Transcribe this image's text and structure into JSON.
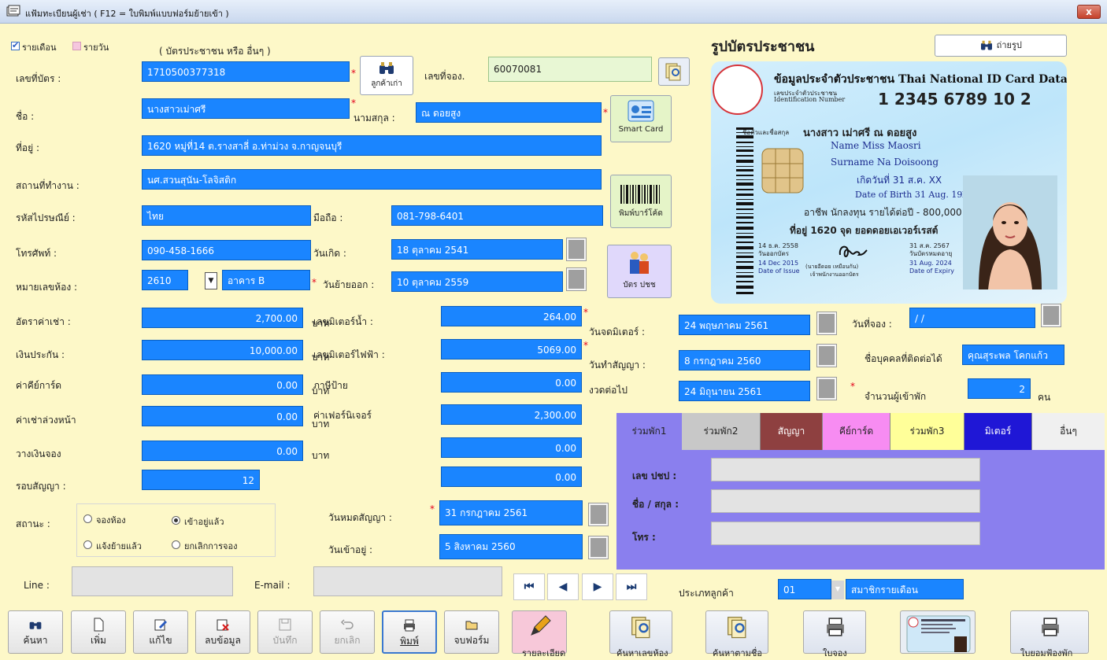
{
  "window": {
    "title": "แฟ้มทะเบียนผู้เช่า ( F12 = ใบพิมพ์แบบฟอร์มย้ายเข้า )",
    "close": "x"
  },
  "rental_type": {
    "monthly": "รายเดือน",
    "daily": "รายวัน",
    "hint": "( บัตรประชาชน หรือ อื่นๆ )"
  },
  "form": {
    "id_label": "เลขที่บัตร :",
    "id_value": "1710500377318",
    "old_customer": "ลูกค้าเก่า",
    "booking_label": "เลขที่จอง.",
    "booking_value": "60070081",
    "name_label": "ชื่อ :",
    "name_value": "นางสาวเม่าศรี",
    "surname_label": "นามสกุล :",
    "surname_value": "ณ ดอยสูง",
    "address_label": "ที่อยู่ :",
    "address_value": "1620 หมู่ที่14 ต.รางสาลี่ อ.ท่าม่วง จ.กาญจนบุรี",
    "workplace_label": "สถานที่ทำงาน :",
    "workplace_value": "นศ.สวนสุนัน-โลจิสติก",
    "postal_label": "รหัสไปรษณีย์ :",
    "postal_value": "ไทย",
    "mobile_label": "มือถือ :",
    "mobile_value": "081-798-6401",
    "phone_label": "โทรศัพท์ :",
    "phone_value": "090-458-1666",
    "birth_label": "วันเกิด :",
    "birth_value": "18 ตุลาคม 2541",
    "room_label": "หมายเลขห้อง :",
    "room_value": "2610",
    "building_value": "อาคาร B",
    "moveout_label": "วันย้ายออก :",
    "moveout_value": "10 ตุลาคม 2559",
    "rent_label": "อัตราค่าเช่า :",
    "rent_value": "2,700.00",
    "deposit_label": "เงินประกัน :",
    "deposit_value": "10,000.00",
    "keycard_label": "ค่าคีย์การ์ด",
    "keycard_value": "0.00",
    "advance_label": "ค่าเช่าล่วงหน้า",
    "advance_value": "0.00",
    "booking_dep_label": "วางเงินจอง",
    "booking_dep_value": "0.00",
    "cycle_label": "รอบสัญญา :",
    "cycle_value": "12",
    "baht": "บาท",
    "water_label": "เลขมิเตอร์น้ำ :",
    "water_value": "264.00",
    "elec_label": "เลขมิเตอร์ไฟฟ้า :",
    "elec_value": "5069.00",
    "sign_tax_label": "ภาษีป้าย",
    "sign_tax_value": "0.00",
    "furniture_label": "ค่าเฟอร์นิเจอร์",
    "furniture_value": "2,300.00",
    "extra1_value": "0.00",
    "extra2_value": "0.00",
    "meter_date_label": "วันจดมิเตอร์ :",
    "meter_date_value": "24 พฤษภาคม 2561",
    "contract_date_label": "วันทำสัญญา :",
    "contract_date_value": "8 กรกฎาคม 2560",
    "next_label": "งวดต่อไป",
    "next_value": "24 มิถุนายน 2561",
    "bookdate_label": "วันที่จอง :",
    "bookdate_value": "/ /",
    "contact_label": "ชื่อบุคคลที่ติดต่อได้",
    "contact_value": "คุณสุระพล โคกแก้ว",
    "occupants_label": "จำนวนผู้เข้าพัก",
    "occupants_value": "2",
    "occupants_unit": "คน",
    "status_label": "สถานะ :",
    "status_opts": [
      "จองห้อง",
      "เข้าอยู่แล้ว",
      "แจ้งย้ายแล้ว",
      "ยกเลิกการจอง"
    ],
    "contract_end_label": "วันหมดสัญญา :",
    "contract_end_value": "31 กรกฎาคม 2561",
    "movein_label": "วันเข้าอยู่ :",
    "movein_value": "5 สิงหาคม 2560",
    "line_label": "Line :",
    "line_value": "",
    "email_label": "E-mail :",
    "email_value": "",
    "custtype_label": "ประเภทลูกค้า",
    "custtype_code": "01",
    "custtype_value": "สมาชิกรายเดือน"
  },
  "side_buttons": {
    "smartcard": "Smart Card",
    "barcode": "พิมพ์บาร์โค้ด",
    "idcard": "บัตร ปชช"
  },
  "photo": {
    "heading": "รูปบัตรประชาชน",
    "take_photo": "ถ่ายรูป"
  },
  "id_card": {
    "title": "ข้อมูลประจำตัวประชาชน Thai National ID Card Data",
    "idnum_th": "เลขประจำตัวประชาชน",
    "idnum_en": "Identification Number",
    "number": "1 2345 6789 10 2",
    "name_th_label": "ชื่อตัวและชื่อสกุล",
    "name_th": "นางสาว เม่าศรี ณ ดอยสูง",
    "name_en": "Name Miss Maosri",
    "surname_en": "Surname Na Doisoong",
    "dob_th": "เกิดวันที่ 31 ส.ค. XX",
    "dob_en": "Date of Birth 31 Aug. 19XX",
    "occupation": "อาชีพ นักลงทุน รายได้ต่อปี - 800,000 บาท",
    "address": "ที่อยู่ 1620 จุด ยอดดอยเอเวอร์เรสต์",
    "issue_th": "14 ธ.ค. 2558",
    "issue_th_lbl": "วันออกบัตร",
    "issue_en": "14 Dec 2015",
    "issue_en_lbl": "Date of Issue",
    "expiry_th": "31 ส.ค. 2567",
    "expiry_th_lbl": "วันบัตรหมดอายุ",
    "expiry_en": "31 Aug. 2024",
    "expiry_en_lbl": "Date of Expiry",
    "signer": "(นายอีดอย เหมือนกัน)",
    "signer_role": "เจ้าพนักงานออกบัตร"
  },
  "tabs": [
    "ร่วมพัก1",
    "ร่วมพัก2",
    "สัญญา",
    "คีย์การ์ด",
    "ร่วมพัก3",
    "มิเตอร์",
    "อื่นๆ"
  ],
  "tab_panel": {
    "id_label": "เลข ปชป :",
    "name_label": "ชื่อ / สกุล :",
    "tel_label": "โทร :"
  },
  "toolbar": {
    "search": "ค้นหา",
    "add": "เพิ่ม",
    "edit": "แก้ไข",
    "delete": "ลบข้อมูล",
    "save": "บันทึก",
    "cancel": "ยกเลิก",
    "print": "พิมพ์",
    "print_form": "จบฟอร์ม",
    "btn9": "รายละเอียด",
    "btn10": "ค้นหาเลขห้อง",
    "btn11": "ค้นหาตามชื่อ",
    "btn12": "ใบจอง",
    "btn14": "ใบยอมฟ้องพัก"
  },
  "colors": {
    "field_blue": "#1a85ff",
    "bg": "#fdf8c8",
    "tab_panel": "#8a7fee",
    "tab_red": "#8e4040",
    "tab_pink": "#f78cf2",
    "tab_yellow": "#ffff99",
    "tab_blue": "#1f17d6"
  }
}
